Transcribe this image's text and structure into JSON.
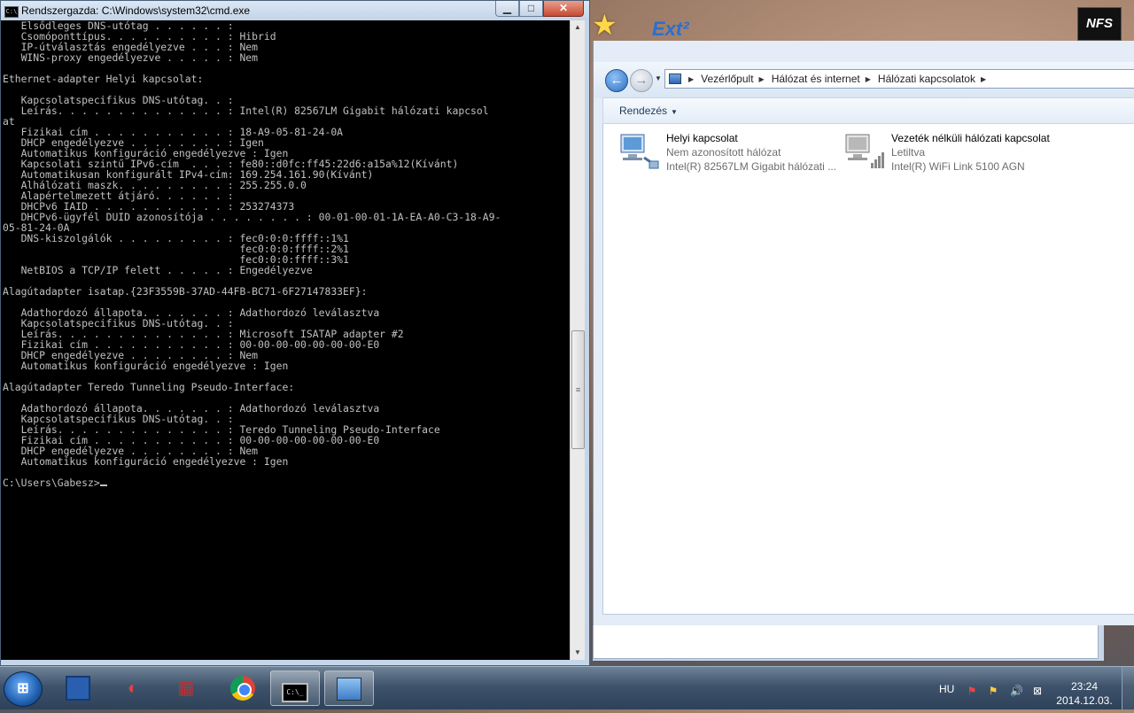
{
  "desktop": {
    "ext_label": "Ext²",
    "nfs_label": "NFS"
  },
  "cmd": {
    "title": "Rendszergazda: C:\\Windows\\system32\\cmd.exe",
    "icon_text": "C:\\",
    "lines": [
      "   Elsődleges DNS-utótag . . . . . . : ",
      "   Csomóponttípus. . . . . . . . . . : Hibrid",
      "   IP-útválasztás engedélyezve . . . : Nem",
      "   WINS-proxy engedélyezve . . . . . : Nem",
      "",
      "Ethernet-adapter Helyi kapcsolat:",
      "",
      "   Kapcsolatspecifikus DNS-utótag. . : ",
      "   Leírás. . . . . . . . . . . . . . : Intel(R) 82567LM Gigabit hálózati kapcsol",
      "at",
      "   Fizikai cím . . . . . . . . . . . : 18-A9-05-81-24-0A",
      "   DHCP engedélyezve . . . . . . . . : Igen",
      "   Automatikus konfiguráció engedélyezve : Igen",
      "   Kapcsolati szintű IPv6-cím  . . . : fe80::d0fc:ff45:22d6:a15a%12(Kívánt)",
      "   Automatikusan konfigurált IPv4-cím: 169.254.161.90(Kívánt)",
      "   Alhálózati maszk. . . . . . . . . : 255.255.0.0",
      "   Alapértelmezett átjáró. . . . . . : ",
      "   DHCPv6 IAID . . . . . . . . . . . : 253274373",
      "   DHCPv6-ügyfél DUID azonosítója . . . . . . . . : 00-01-00-01-1A-EA-A0-C3-18-A9-",
      "05-81-24-0A",
      "   DNS-kiszolgálók . . . . . . . . . : fec0:0:0:ffff::1%1",
      "                                       fec0:0:0:ffff::2%1",
      "                                       fec0:0:0:ffff::3%1",
      "   NetBIOS a TCP/IP felett . . . . . : Engedélyezve",
      "",
      "Alagútadapter isatap.{23F3559B-37AD-44FB-BC71-6F27147833EF}:",
      "",
      "   Adathordozó állapota. . . . . . . : Adathordozó leválasztva",
      "   Kapcsolatspecifikus DNS-utótag. . : ",
      "   Leírás. . . . . . . . . . . . . . : Microsoft ISATAP adapter #2",
      "   Fizikai cím . . . . . . . . . . . : 00-00-00-00-00-00-00-E0",
      "   DHCP engedélyezve . . . . . . . . : Nem",
      "   Automatikus konfiguráció engedélyezve : Igen",
      "",
      "Alagútadapter Teredo Tunneling Pseudo-Interface:",
      "",
      "   Adathordozó állapota. . . . . . . : Adathordozó leválasztva",
      "   Kapcsolatspecifikus DNS-utótag. . : ",
      "   Leírás. . . . . . . . . . . . . . : Teredo Tunneling Pseudo-Interface",
      "   Fizikai cím . . . . . . . . . . . : 00-00-00-00-00-00-00-E0",
      "   DHCP engedélyezve . . . . . . . . : Nem",
      "   Automatikus konfiguráció engedélyezve : Igen",
      "",
      "C:\\Users\\Gabesz>"
    ]
  },
  "explorer": {
    "breadcrumb": [
      "Vezérlőpult",
      "Hálózat és internet",
      "Hálózati kapcsolatok"
    ],
    "organize_label": "Rendezés",
    "connections": [
      {
        "name": "Helyi kapcsolat",
        "status": "Nem azonosított hálózat",
        "device": "Intel(R) 82567LM Gigabit hálózati ..."
      },
      {
        "name": "Vezeték nélküli hálózati kapcsolat",
        "status": "Letiltva",
        "device": "Intel(R) WiFi Link 5100 AGN"
      }
    ]
  },
  "taskbar": {
    "start_glyph": "⊞",
    "language": "HU",
    "time": "23:24",
    "date": "2014.12.03.",
    "cmd_icon_text": "C:\\_"
  }
}
